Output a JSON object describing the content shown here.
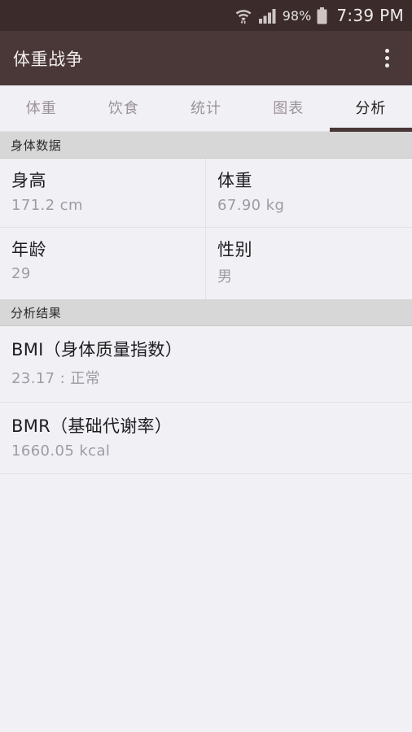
{
  "status_bar": {
    "wifi_icon": "wifi-with-transfer-arrows-icon",
    "signal_icon": "cellular-signal-icon",
    "battery_percent": "98%",
    "battery_icon": "battery-full-icon",
    "time": "7:39 PM"
  },
  "app_bar": {
    "title": "体重战争",
    "overflow_icon": "overflow-menu-icon"
  },
  "tabs": [
    {
      "label": "体重",
      "active": false
    },
    {
      "label": "饮食",
      "active": false
    },
    {
      "label": "统计",
      "active": false
    },
    {
      "label": "图表",
      "active": false
    },
    {
      "label": "分析",
      "active": true
    }
  ],
  "sections": [
    {
      "header": "身体数据",
      "rows": [
        [
          {
            "label": "身高",
            "value": "171.2 cm"
          },
          {
            "label": "体重",
            "value": "67.90 kg"
          }
        ],
        [
          {
            "label": "年龄",
            "value": "29"
          },
          {
            "label": "性别",
            "value": "男"
          }
        ]
      ]
    },
    {
      "header": "分析结果",
      "results": [
        {
          "title": "BMI（身体质量指数）",
          "value": "23.17 : 正常"
        },
        {
          "title": "BMR（基础代谢率）",
          "value": "1660.05 kcal"
        }
      ]
    }
  ],
  "colors": {
    "status_bar_bg": "#3b2b2b",
    "app_bar_bg": "#4a3737",
    "accent": "#4a3737",
    "page_bg": "#f1f0f5",
    "section_header_bg": "#d7d7d7",
    "primary_text": "#1d1d1f",
    "secondary_text": "#9e9ba4",
    "inactive_tab_text": "#9b9399"
  }
}
